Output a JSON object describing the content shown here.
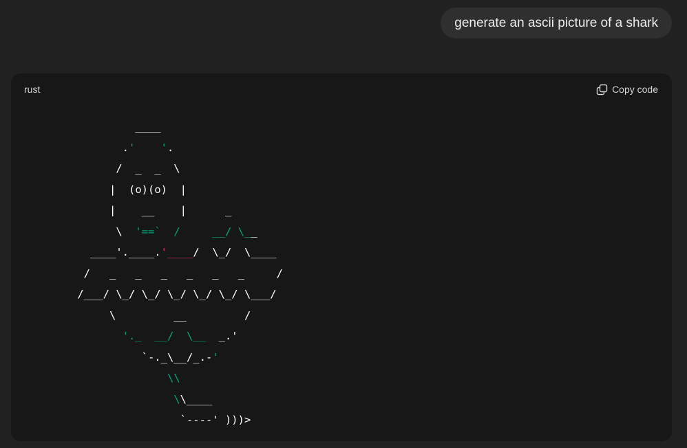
{
  "user_message": "generate an ascii picture of a shark",
  "code_block": {
    "language": "rust",
    "copy_label": "Copy code"
  },
  "ascii_lines": [
    [
      {
        "t": "          ____"
      }
    ],
    [
      {
        "t": "        ."
      },
      {
        "t": "'",
        "c": "g"
      },
      {
        "t": "    "
      },
      {
        "t": "'",
        "c": "g"
      },
      {
        "t": "."
      }
    ],
    [
      {
        "t": "       /  _  _  \\"
      }
    ],
    [
      {
        "t": "      |  (o)(o)  |"
      }
    ],
    [
      {
        "t": "      |    __    |      _"
      }
    ],
    [
      {
        "t": "       \\  "
      },
      {
        "t": "'==`  /",
        "c": "g"
      },
      {
        "t": "     "
      },
      {
        "t": "__/ \\_",
        "c": "g"
      },
      {
        "t": "_"
      }
    ],
    [
      {
        "t": "   ____'.____."
      },
      {
        "t": "'____",
        "c": "r"
      },
      {
        "t": "/  \\_/  \\____"
      }
    ],
    [
      {
        "t": "  /   _   _   _   _   _   _     /"
      }
    ],
    [
      {
        "t": " /___/ \\_/ \\_/ \\_/ \\_/ \\_/ \\___/"
      }
    ],
    [
      {
        "t": "      \\         __         /"
      }
    ],
    [
      {
        "t": "        "
      },
      {
        "t": "'._  __/  \\__",
        "c": "g"
      },
      {
        "t": "  _.'"
      }
    ],
    [
      {
        "t": "           `-._\\__/_.-"
      },
      {
        "t": "'",
        "c": "g"
      }
    ],
    [
      {
        "t": "               "
      },
      {
        "t": "\\\\",
        "c": "g"
      }
    ],
    [
      {
        "t": "                "
      },
      {
        "t": "\\",
        "c": "g"
      },
      {
        "t": "\\____"
      }
    ],
    [
      {
        "t": "                 `----' )))>"
      }
    ]
  ]
}
